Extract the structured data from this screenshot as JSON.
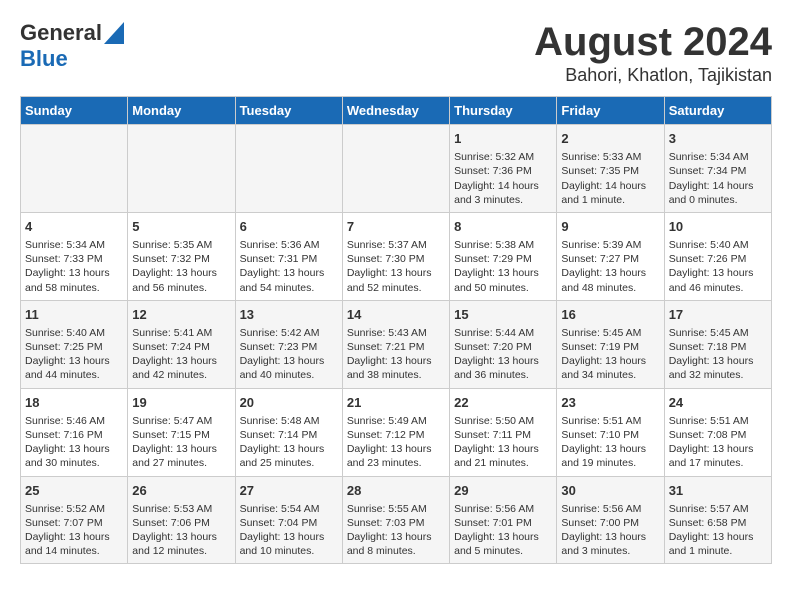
{
  "header": {
    "logo_line1": "General",
    "logo_line2": "Blue",
    "title": "August 2024",
    "subtitle": "Bahori, Khatlon, Tajikistan"
  },
  "calendar": {
    "days_of_week": [
      "Sunday",
      "Monday",
      "Tuesday",
      "Wednesday",
      "Thursday",
      "Friday",
      "Saturday"
    ],
    "weeks": [
      [
        {
          "day": "",
          "content": ""
        },
        {
          "day": "",
          "content": ""
        },
        {
          "day": "",
          "content": ""
        },
        {
          "day": "",
          "content": ""
        },
        {
          "day": "1",
          "content": "Sunrise: 5:32 AM\nSunset: 7:36 PM\nDaylight: 14 hours\nand 3 minutes."
        },
        {
          "day": "2",
          "content": "Sunrise: 5:33 AM\nSunset: 7:35 PM\nDaylight: 14 hours\nand 1 minute."
        },
        {
          "day": "3",
          "content": "Sunrise: 5:34 AM\nSunset: 7:34 PM\nDaylight: 14 hours\nand 0 minutes."
        }
      ],
      [
        {
          "day": "4",
          "content": "Sunrise: 5:34 AM\nSunset: 7:33 PM\nDaylight: 13 hours\nand 58 minutes."
        },
        {
          "day": "5",
          "content": "Sunrise: 5:35 AM\nSunset: 7:32 PM\nDaylight: 13 hours\nand 56 minutes."
        },
        {
          "day": "6",
          "content": "Sunrise: 5:36 AM\nSunset: 7:31 PM\nDaylight: 13 hours\nand 54 minutes."
        },
        {
          "day": "7",
          "content": "Sunrise: 5:37 AM\nSunset: 7:30 PM\nDaylight: 13 hours\nand 52 minutes."
        },
        {
          "day": "8",
          "content": "Sunrise: 5:38 AM\nSunset: 7:29 PM\nDaylight: 13 hours\nand 50 minutes."
        },
        {
          "day": "9",
          "content": "Sunrise: 5:39 AM\nSunset: 7:27 PM\nDaylight: 13 hours\nand 48 minutes."
        },
        {
          "day": "10",
          "content": "Sunrise: 5:40 AM\nSunset: 7:26 PM\nDaylight: 13 hours\nand 46 minutes."
        }
      ],
      [
        {
          "day": "11",
          "content": "Sunrise: 5:40 AM\nSunset: 7:25 PM\nDaylight: 13 hours\nand 44 minutes."
        },
        {
          "day": "12",
          "content": "Sunrise: 5:41 AM\nSunset: 7:24 PM\nDaylight: 13 hours\nand 42 minutes."
        },
        {
          "day": "13",
          "content": "Sunrise: 5:42 AM\nSunset: 7:23 PM\nDaylight: 13 hours\nand 40 minutes."
        },
        {
          "day": "14",
          "content": "Sunrise: 5:43 AM\nSunset: 7:21 PM\nDaylight: 13 hours\nand 38 minutes."
        },
        {
          "day": "15",
          "content": "Sunrise: 5:44 AM\nSunset: 7:20 PM\nDaylight: 13 hours\nand 36 minutes."
        },
        {
          "day": "16",
          "content": "Sunrise: 5:45 AM\nSunset: 7:19 PM\nDaylight: 13 hours\nand 34 minutes."
        },
        {
          "day": "17",
          "content": "Sunrise: 5:45 AM\nSunset: 7:18 PM\nDaylight: 13 hours\nand 32 minutes."
        }
      ],
      [
        {
          "day": "18",
          "content": "Sunrise: 5:46 AM\nSunset: 7:16 PM\nDaylight: 13 hours\nand 30 minutes."
        },
        {
          "day": "19",
          "content": "Sunrise: 5:47 AM\nSunset: 7:15 PM\nDaylight: 13 hours\nand 27 minutes."
        },
        {
          "day": "20",
          "content": "Sunrise: 5:48 AM\nSunset: 7:14 PM\nDaylight: 13 hours\nand 25 minutes."
        },
        {
          "day": "21",
          "content": "Sunrise: 5:49 AM\nSunset: 7:12 PM\nDaylight: 13 hours\nand 23 minutes."
        },
        {
          "day": "22",
          "content": "Sunrise: 5:50 AM\nSunset: 7:11 PM\nDaylight: 13 hours\nand 21 minutes."
        },
        {
          "day": "23",
          "content": "Sunrise: 5:51 AM\nSunset: 7:10 PM\nDaylight: 13 hours\nand 19 minutes."
        },
        {
          "day": "24",
          "content": "Sunrise: 5:51 AM\nSunset: 7:08 PM\nDaylight: 13 hours\nand 17 minutes."
        }
      ],
      [
        {
          "day": "25",
          "content": "Sunrise: 5:52 AM\nSunset: 7:07 PM\nDaylight: 13 hours\nand 14 minutes."
        },
        {
          "day": "26",
          "content": "Sunrise: 5:53 AM\nSunset: 7:06 PM\nDaylight: 13 hours\nand 12 minutes."
        },
        {
          "day": "27",
          "content": "Sunrise: 5:54 AM\nSunset: 7:04 PM\nDaylight: 13 hours\nand 10 minutes."
        },
        {
          "day": "28",
          "content": "Sunrise: 5:55 AM\nSunset: 7:03 PM\nDaylight: 13 hours\nand 8 minutes."
        },
        {
          "day": "29",
          "content": "Sunrise: 5:56 AM\nSunset: 7:01 PM\nDaylight: 13 hours\nand 5 minutes."
        },
        {
          "day": "30",
          "content": "Sunrise: 5:56 AM\nSunset: 7:00 PM\nDaylight: 13 hours\nand 3 minutes."
        },
        {
          "day": "31",
          "content": "Sunrise: 5:57 AM\nSunset: 6:58 PM\nDaylight: 13 hours\nand 1 minute."
        }
      ]
    ]
  }
}
